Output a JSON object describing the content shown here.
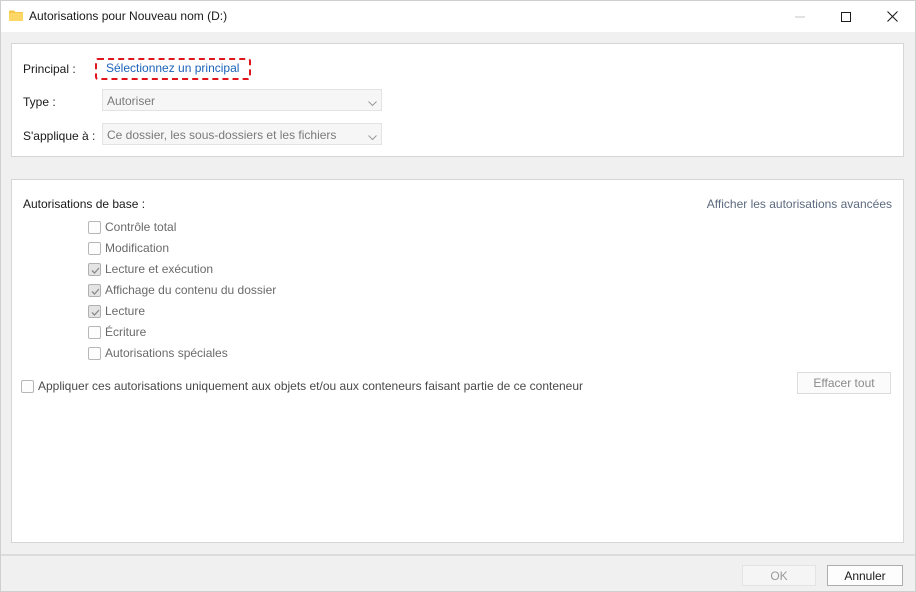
{
  "window": {
    "title": "Autorisations pour Nouveau nom (D:)",
    "icon": "folder-icon"
  },
  "principal_section": {
    "principal_label": "Principal :",
    "principal_link": "Sélectionnez un principal",
    "type_label": "Type :",
    "type_value": "Autoriser",
    "applies_label": "S'applique à :",
    "applies_value": "Ce dossier, les sous-dossiers et les fichiers"
  },
  "permissions": {
    "heading": "Autorisations de base :",
    "advanced_link": "Afficher les autorisations avancées",
    "items": [
      {
        "label": "Contrôle total",
        "checked": false
      },
      {
        "label": "Modification",
        "checked": false
      },
      {
        "label": "Lecture et exécution",
        "checked": true
      },
      {
        "label": "Affichage du contenu du dossier",
        "checked": true
      },
      {
        "label": "Lecture",
        "checked": true
      },
      {
        "label": "Écriture",
        "checked": false
      },
      {
        "label": "Autorisations spéciales",
        "checked": false
      }
    ],
    "apply_only_label": "Appliquer ces autorisations uniquement aux objets et/ou aux conteneurs faisant partie de ce conteneur",
    "apply_only_checked": false,
    "clear_all_label": "Effacer tout"
  },
  "footer": {
    "ok_label": "OK",
    "cancel_label": "Annuler"
  },
  "colors": {
    "link": "#1c62b8",
    "highlight_border": "#e0161d",
    "folder": "#f4c64a"
  }
}
